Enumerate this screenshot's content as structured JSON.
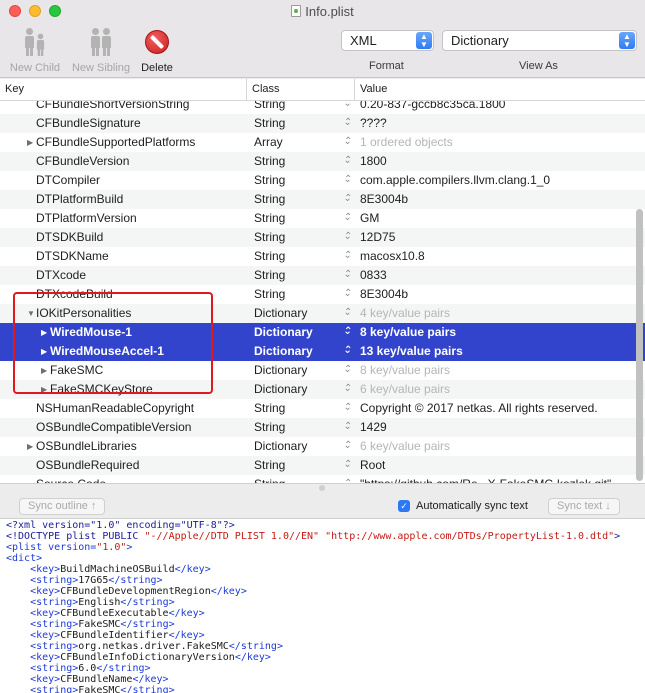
{
  "window": {
    "title": "Info.plist"
  },
  "toolbar": {
    "new_child": "New Child",
    "new_sibling": "New Sibling",
    "delete": "Delete",
    "format": {
      "value": "XML",
      "caption": "Format"
    },
    "view_as": {
      "value": "Dictionary",
      "caption": "View As"
    }
  },
  "columns": {
    "key": "Key",
    "class": "Class",
    "value": "Value"
  },
  "rows": [
    {
      "key": "CFBundleShortVersionString",
      "class": "String",
      "value": "0.20-837-gccb8c35ca.1800",
      "level": 0,
      "expander": "none"
    },
    {
      "key": "CFBundleSignature",
      "class": "String",
      "value": "????",
      "level": 0,
      "expander": "none"
    },
    {
      "key": "CFBundleSupportedPlatforms",
      "class": "Array",
      "value": "1 ordered objects",
      "level": 0,
      "expander": "collapsed",
      "dim": true
    },
    {
      "key": "CFBundleVersion",
      "class": "String",
      "value": "1800",
      "level": 0,
      "expander": "none"
    },
    {
      "key": "DTCompiler",
      "class": "String",
      "value": "com.apple.compilers.llvm.clang.1_0",
      "level": 0,
      "expander": "none"
    },
    {
      "key": "DTPlatformBuild",
      "class": "String",
      "value": "8E3004b",
      "level": 0,
      "expander": "none"
    },
    {
      "key": "DTPlatformVersion",
      "class": "String",
      "value": "GM",
      "level": 0,
      "expander": "none"
    },
    {
      "key": "DTSDKBuild",
      "class": "String",
      "value": "12D75",
      "level": 0,
      "expander": "none"
    },
    {
      "key": "DTSDKName",
      "class": "String",
      "value": "macosx10.8",
      "level": 0,
      "expander": "none"
    },
    {
      "key": "DTXcode",
      "class": "String",
      "value": "0833",
      "level": 0,
      "expander": "none"
    },
    {
      "key": "DTXcodeBuild",
      "class": "String",
      "value": "8E3004b",
      "level": 0,
      "expander": "none"
    },
    {
      "key": "IOKitPersonalities",
      "class": "Dictionary",
      "value": "4 key/value pairs",
      "level": 0,
      "expander": "expanded",
      "dim": true
    },
    {
      "key": "WiredMouse-1",
      "class": "Dictionary",
      "value": "8 key/value pairs",
      "level": 1,
      "expander": "collapsed",
      "selected": true
    },
    {
      "key": "WiredMouseAccel-1",
      "class": "Dictionary",
      "value": "13 key/value pairs",
      "level": 1,
      "expander": "collapsed",
      "selected": true
    },
    {
      "key": "FakeSMC",
      "class": "Dictionary",
      "value": "8 key/value pairs",
      "level": 1,
      "expander": "collapsed",
      "dim": true
    },
    {
      "key": "FakeSMCKeyStore",
      "class": "Dictionary",
      "value": "6 key/value pairs",
      "level": 1,
      "expander": "collapsed",
      "dim": true
    },
    {
      "key": "NSHumanReadableCopyright",
      "class": "String",
      "value": "Copyright © 2017 netkas. All rights reserved.",
      "level": 0,
      "expander": "none"
    },
    {
      "key": "OSBundleCompatibleVersion",
      "class": "String",
      "value": "1429",
      "level": 0,
      "expander": "none"
    },
    {
      "key": "OSBundleLibraries",
      "class": "Dictionary",
      "value": "6 key/value pairs",
      "level": 0,
      "expander": "collapsed",
      "dim": true
    },
    {
      "key": "OSBundleRequired",
      "class": "String",
      "value": "Root",
      "level": 0,
      "expander": "none"
    },
    {
      "key": "Source Code",
      "class": "String",
      "value": "\"https://github.com/Re...X-FakeSMC-kozlek.git\"",
      "level": 0,
      "expander": "none"
    }
  ],
  "sync": {
    "sync_outline": "Sync outline ↑",
    "auto_sync_label": "Automatically sync text",
    "auto_sync_checked": true,
    "sync_text": "Sync text ↓"
  },
  "source_lines": [
    [
      [
        "pi",
        "<?xml version=\"1.0\" encoding=\"UTF-8\"?>"
      ]
    ],
    [
      [
        "pi",
        "<!DOCTYPE plist PUBLIC "
      ],
      [
        "str",
        "\"-//Apple//DTD PLIST 1.0//EN\""
      ],
      [
        "pi",
        " "
      ],
      [
        "str",
        "\"http://www.apple.com/DTDs/PropertyList-1.0.dtd\""
      ],
      [
        "pi",
        ">"
      ]
    ],
    [
      [
        "tag",
        "<plist version="
      ],
      [
        "str",
        "\"1.0\""
      ],
      [
        "tag",
        ">"
      ]
    ],
    [
      [
        "tag",
        "<dict>"
      ]
    ],
    [
      [
        "text",
        "    "
      ],
      [
        "tag",
        "<key>"
      ],
      [
        "text",
        "BuildMachineOSBuild"
      ],
      [
        "tag",
        "</key>"
      ]
    ],
    [
      [
        "text",
        "    "
      ],
      [
        "tag",
        "<string>"
      ],
      [
        "text",
        "17G65"
      ],
      [
        "tag",
        "</string>"
      ]
    ],
    [
      [
        "text",
        "    "
      ],
      [
        "tag",
        "<key>"
      ],
      [
        "text",
        "CFBundleDevelopmentRegion"
      ],
      [
        "tag",
        "</key>"
      ]
    ],
    [
      [
        "text",
        "    "
      ],
      [
        "tag",
        "<string>"
      ],
      [
        "text",
        "English"
      ],
      [
        "tag",
        "</string>"
      ]
    ],
    [
      [
        "text",
        "    "
      ],
      [
        "tag",
        "<key>"
      ],
      [
        "text",
        "CFBundleExecutable"
      ],
      [
        "tag",
        "</key>"
      ]
    ],
    [
      [
        "text",
        "    "
      ],
      [
        "tag",
        "<string>"
      ],
      [
        "text",
        "FakeSMC"
      ],
      [
        "tag",
        "</string>"
      ]
    ],
    [
      [
        "text",
        "    "
      ],
      [
        "tag",
        "<key>"
      ],
      [
        "text",
        "CFBundleIdentifier"
      ],
      [
        "tag",
        "</key>"
      ]
    ],
    [
      [
        "text",
        "    "
      ],
      [
        "tag",
        "<string>"
      ],
      [
        "text",
        "org.netkas.driver.FakeSMC"
      ],
      [
        "tag",
        "</string>"
      ]
    ],
    [
      [
        "text",
        "    "
      ],
      [
        "tag",
        "<key>"
      ],
      [
        "text",
        "CFBundleInfoDictionaryVersion"
      ],
      [
        "tag",
        "</key>"
      ]
    ],
    [
      [
        "text",
        "    "
      ],
      [
        "tag",
        "<string>"
      ],
      [
        "text",
        "6.0"
      ],
      [
        "tag",
        "</string>"
      ]
    ],
    [
      [
        "text",
        "    "
      ],
      [
        "tag",
        "<key>"
      ],
      [
        "text",
        "CFBundleName"
      ],
      [
        "tag",
        "</key>"
      ]
    ],
    [
      [
        "text",
        "    "
      ],
      [
        "tag",
        "<string>"
      ],
      [
        "text",
        "FakeSMC"
      ],
      [
        "tag",
        "</string>"
      ]
    ]
  ]
}
